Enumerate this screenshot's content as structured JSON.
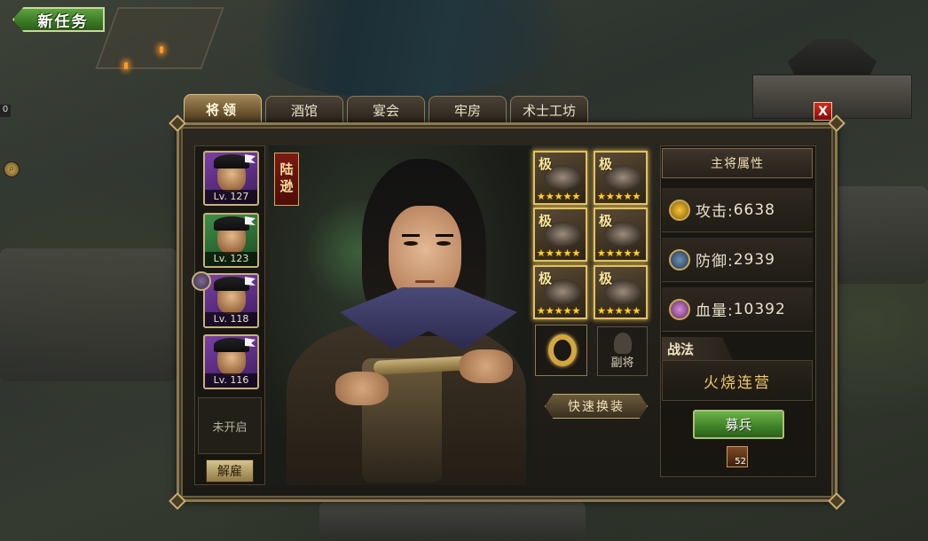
{
  "new_quest": {
    "label": "新任务"
  },
  "side": {
    "small_value": "0"
  },
  "tabs": [
    {
      "label": "将领",
      "active": true
    },
    {
      "label": "酒馆",
      "active": false
    },
    {
      "label": "宴会",
      "active": false
    },
    {
      "label": "牢房",
      "active": false
    },
    {
      "label": "术士工坊",
      "active": false
    }
  ],
  "close_label": "X",
  "generals": [
    {
      "level": "Lv. 127",
      "frame": "purple"
    },
    {
      "level": "Lv. 123",
      "frame": "green"
    },
    {
      "level": "Lv. 118",
      "frame": "purple"
    },
    {
      "level": "Lv. 116",
      "frame": "purple"
    }
  ],
  "empty_slot": "未开启",
  "fire_button": "解雇",
  "hero_name": "陆逊",
  "equipment": [
    {
      "rank": "极",
      "stars": "★★★★★"
    },
    {
      "rank": "极",
      "stars": "★★★★★"
    },
    {
      "rank": "极",
      "stars": "★★★★★"
    },
    {
      "rank": "极",
      "stars": "★★★★★"
    },
    {
      "rank": "极",
      "stars": "★★★★★"
    },
    {
      "rank": "极",
      "stars": "★★★★★"
    }
  ],
  "deputy_label": "副将",
  "quick_equip": "快速换装",
  "attributes": {
    "title": "主将属性",
    "attack": {
      "label": "攻击:",
      "value": "6638"
    },
    "defense": {
      "label": "防御:",
      "value": "2939"
    },
    "hp": {
      "label": "血量:",
      "value": "10392"
    }
  },
  "tactic": {
    "title": "战法",
    "name": "火烧连营"
  },
  "recruit_button": "募兵",
  "troop_count": "52",
  "colors": {
    "accent_gold": "#c6b17a",
    "button_green": "#3e8126",
    "tactic_text": "#f3c866"
  }
}
